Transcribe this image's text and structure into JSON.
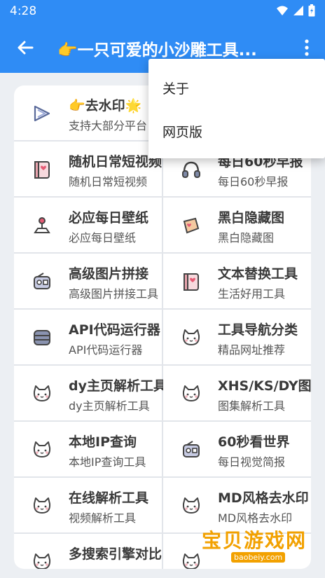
{
  "status_bar": {
    "time": "4:28"
  },
  "app_bar": {
    "title": "👉一只可爱的小沙雕工具..."
  },
  "overflow_menu": {
    "items": [
      "关于",
      "网页版"
    ]
  },
  "tools": [
    {
      "title": "👉去水印🌟",
      "subtitle": "支持大部分平台",
      "icon": "play-arrow-icon",
      "wide": true
    },
    {
      "title": "随机日常短视频",
      "subtitle": "随机日常短视频",
      "icon": "photo-album-icon"
    },
    {
      "title": "每日60秒早报",
      "subtitle": "每日60秒早报",
      "icon": "headphones-icon"
    },
    {
      "title": "必应每日壁纸",
      "subtitle": "必应每日壁纸",
      "icon": "joystick-icon"
    },
    {
      "title": "黑白隐藏图",
      "subtitle": "黑白隐藏图",
      "icon": "scroll-icon"
    },
    {
      "title": "高级图片拼接",
      "subtitle": "高级图片拼接工具",
      "icon": "radio-icon"
    },
    {
      "title": "文本替换工具",
      "subtitle": "生活好用工具",
      "icon": "photo-album-icon"
    },
    {
      "title": "API代码运行器",
      "subtitle": "API代码运行器",
      "icon": "server-icon"
    },
    {
      "title": "工具导航分类",
      "subtitle": "精品网址推荐",
      "icon": "cat-icon"
    },
    {
      "title": "dy主页解析工具",
      "subtitle": "dy主页解析工具",
      "icon": "cat-icon"
    },
    {
      "title": "XHS/KS/DY图集",
      "subtitle": "图集解析工具",
      "icon": "cat-icon"
    },
    {
      "title": "本地IP查询",
      "subtitle": "本地IP查询工具",
      "icon": "cat-icon"
    },
    {
      "title": "60秒看世界",
      "subtitle": "每日视觉简报",
      "icon": "radio-icon"
    },
    {
      "title": "在线解析工具",
      "subtitle": "视频解析工具",
      "icon": "cat-icon"
    },
    {
      "title": "MD风格去水印",
      "subtitle": "MD风格去水印",
      "icon": "cat-icon"
    },
    {
      "title": "多搜索引擎对比",
      "subtitle": "",
      "icon": "cat-icon"
    },
    {
      "title": "",
      "subtitle": "",
      "icon": "cat-icon"
    }
  ],
  "watermark": {
    "text": "宝贝游戏网",
    "url": "baobeiy.com"
  },
  "colors": {
    "primary": "#2f8cf5",
    "background": "#eceff3",
    "card": "#ffffff",
    "watermark": "#f2a100"
  }
}
